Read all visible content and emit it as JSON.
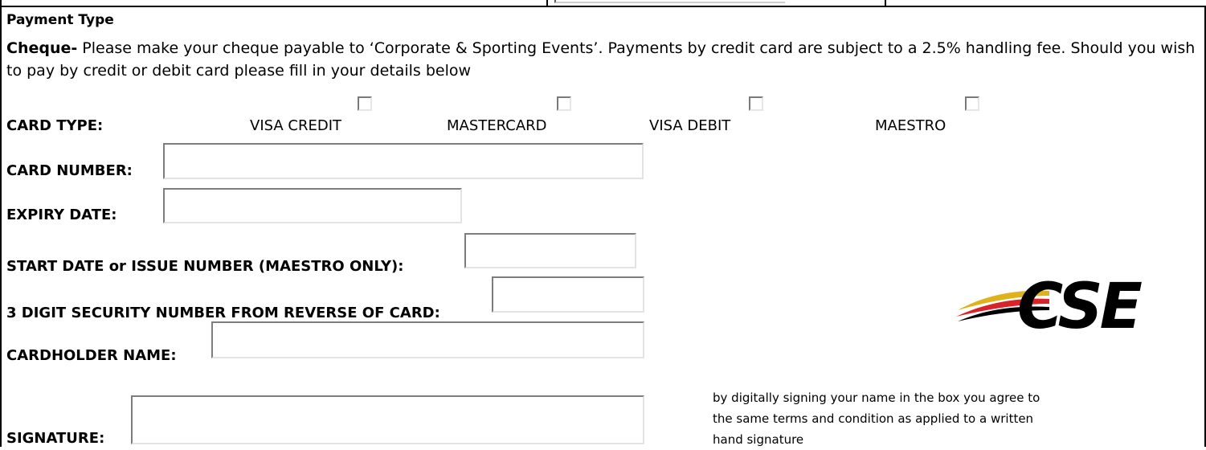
{
  "section": {
    "title": "Payment Type",
    "lead": "Cheque-",
    "body": " Please make your cheque payable to ‘Corporate & Sporting Events’. Payments by credit card are subject to a 2.5% handling fee. Should you wish to pay by credit  or debit card please fill in your details below"
  },
  "card_type": {
    "label": "CARD TYPE:",
    "options": [
      "VISA CREDIT",
      "MASTERCARD",
      "VISA DEBIT",
      "MAESTRO"
    ]
  },
  "fields": {
    "card_number": "CARD NUMBER:",
    "expiry_date": "EXPIRY DATE:",
    "start_date": "START DATE or ISSUE NUMBER (MAESTRO ONLY):",
    "security": "3 DIGIT SECURITY NUMBER FROM REVERSE OF CARD:",
    "cardholder": "CARDHOLDER NAME:",
    "signature": "SIGNATURE:"
  },
  "signature_note": "by digitally signing your name in the box you agree to the same terms and condition as applied to a written hand signature",
  "logo": {
    "text": "CSE"
  },
  "colors": {
    "frame": "#000000",
    "logo_gold": "#e0b21a",
    "logo_red": "#d8232a",
    "logo_black": "#000000"
  }
}
